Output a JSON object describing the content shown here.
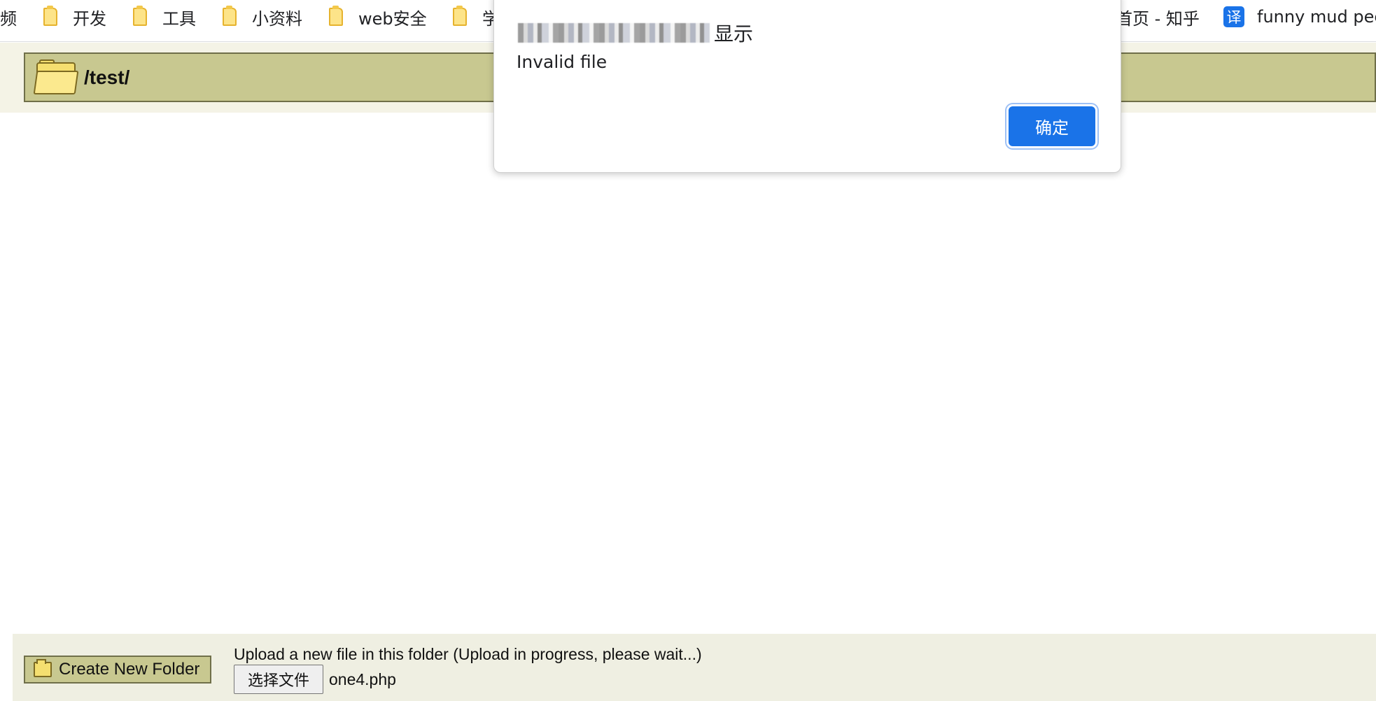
{
  "bookmarks": {
    "items": [
      {
        "label": "频"
      },
      {
        "label": "开发"
      },
      {
        "label": "工具"
      },
      {
        "label": "小资料"
      },
      {
        "label": "web安全"
      },
      {
        "label": "学"
      },
      {
        "label": "首页 - 知乎"
      },
      {
        "label": "funny mud pee"
      }
    ],
    "translate_glyph": "译"
  },
  "file_manager": {
    "current_path": "/test/",
    "create_folder_label": "Create New Folder",
    "upload_prompt": "Upload a new file in this folder (Upload in progress, please wait...)",
    "choose_file_label": "选择文件",
    "selected_file": "one4.php"
  },
  "dialog": {
    "title_suffix": "显示",
    "message": "Invalid file",
    "ok_label": "确定"
  },
  "colors": {
    "header_bg": "#c8c890",
    "header_border": "#6f6f49",
    "panel_bg": "#efefe2",
    "accent_blue": "#1a73e8"
  }
}
